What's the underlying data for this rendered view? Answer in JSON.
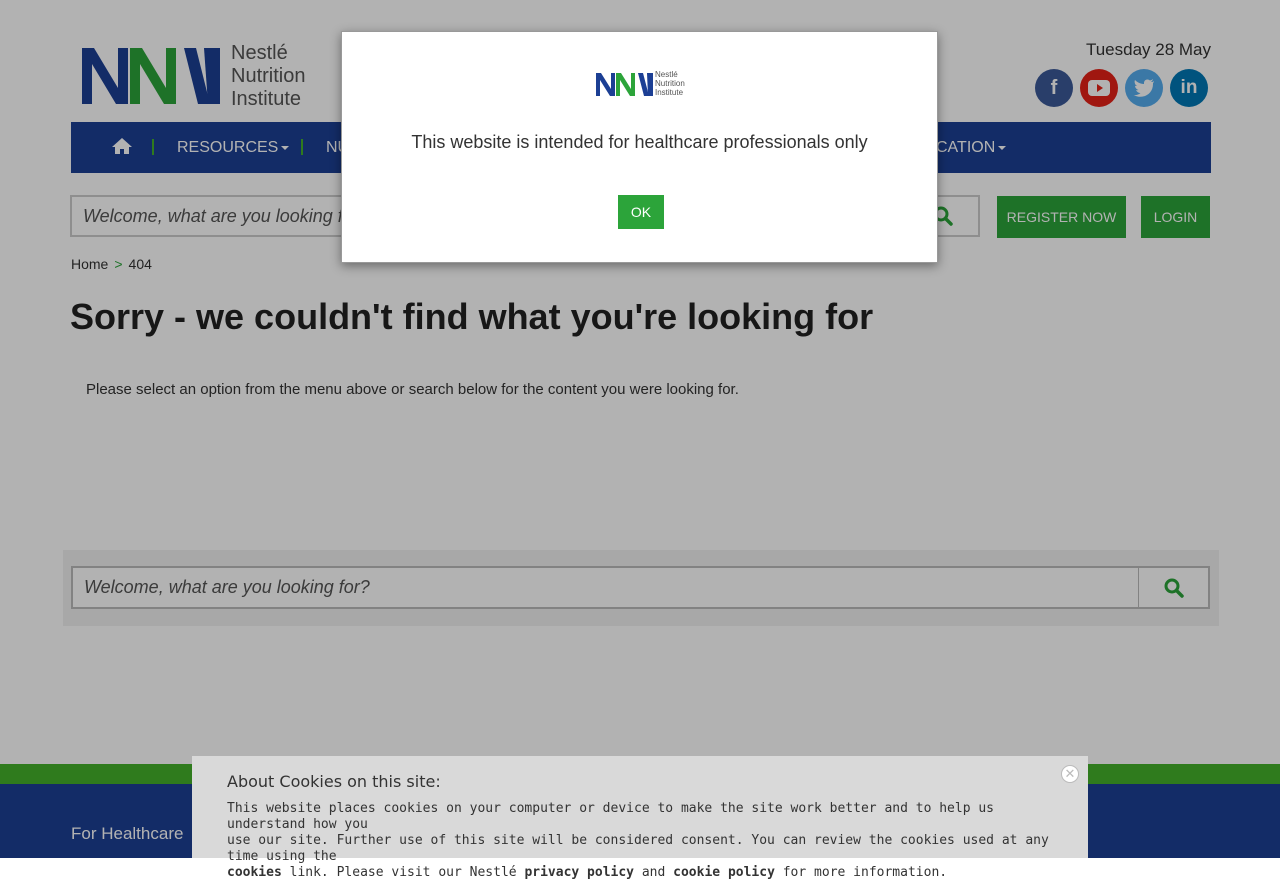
{
  "header": {
    "logo_text": [
      "Nestlé",
      "Nutrition",
      "Institute"
    ],
    "date": "Tuesday 28 May",
    "social_icons": [
      "facebook-icon",
      "youtube-icon",
      "twitter-icon",
      "linkedin-icon"
    ]
  },
  "nav": {
    "home_icon": "home-icon",
    "items": [
      {
        "label": "RESOURCES"
      },
      {
        "label": "NU"
      },
      {
        "label": "CATION"
      }
    ]
  },
  "search": {
    "placeholder": "Welcome, what are you looking for?",
    "button_icon": "search-icon"
  },
  "account": {
    "register_label": "REGISTER NOW",
    "login_label": "LOGIN"
  },
  "breadcrumb": {
    "home": "Home",
    "separator": ">",
    "current": "404"
  },
  "main": {
    "title": "Sorry - we couldn't find what you're looking for",
    "subtext": "Please select an option from the menu above or search below for the content you were looking for."
  },
  "footer": {
    "text": "For Healthcare"
  },
  "modal": {
    "logo_text": [
      "Nestlé",
      "Nutrition",
      "Institute"
    ],
    "message": "This website is intended for healthcare professionals only",
    "ok_label": "OK"
  },
  "cookie_banner": {
    "title": "About Cookies on this site:",
    "line1": "This website places cookies on your computer or device to make the site work better and to help us understand how you",
    "line2": "use our site. Further use of this site will be considered consent. You can review the cookies used at any time using the",
    "link_cookies": "cookies",
    "line3a": "link. Please visit our Nestlé",
    "link_privacy": "privacy policy",
    "line3b": "and",
    "link_cookie_policy": "cookie policy",
    "line3c": "for more information."
  },
  "colors": {
    "brand_blue": "#1c3f94",
    "brand_green": "#2ca43a",
    "nav_separator": "#44b02a"
  }
}
